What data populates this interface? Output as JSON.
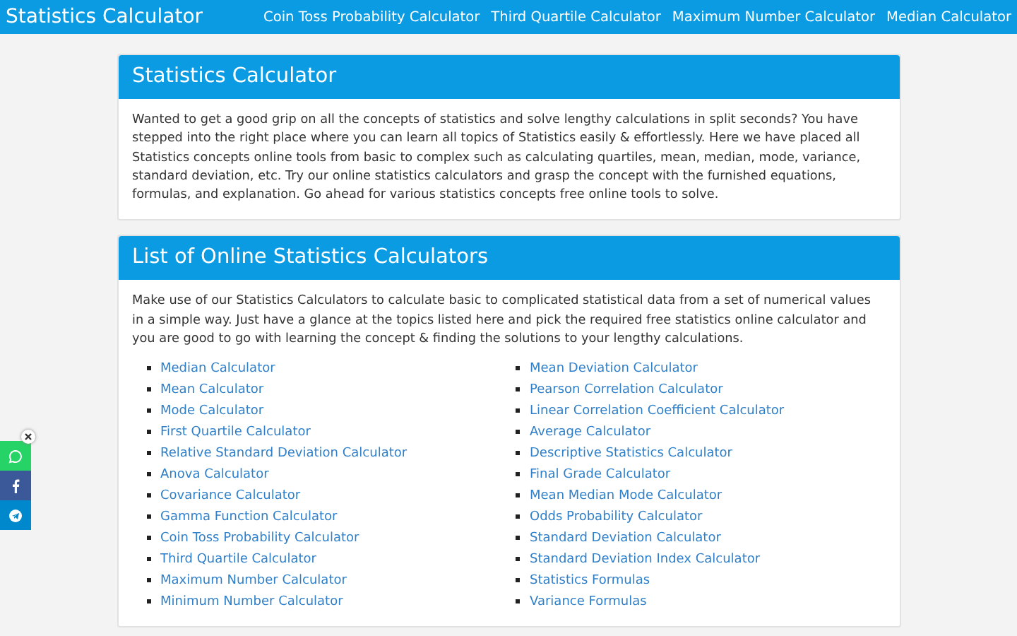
{
  "navbar": {
    "brand": "Statistics Calculator",
    "links": [
      "Coin Toss Probability Calculator",
      "Third Quartile Calculator",
      "Maximum Number Calculator",
      "Median Calculator"
    ]
  },
  "intro": {
    "title": "Statistics Calculator",
    "text": "Wanted to get a good grip on all the concepts of statistics and solve lengthy calculations in split seconds? You have stepped into the right place where you can learn all topics of Statistics easily & effortlessly. Here we have placed all Statistics concepts online tools from basic to complex such as calculating quartiles, mean, median, mode, variance, standard deviation, etc. Try our online statistics calculators and grasp the concept with the furnished equations, formulas, and explanation. Go ahead for various statistics concepts free online tools to solve."
  },
  "list_section": {
    "title": "List of Online Statistics Calculators",
    "text": "Make use of our Statistics Calculators to calculate basic to complicated statistical data from a set of numerical values in a simple way. Just have a glance at the topics listed here and pick the required free statistics online calculator and you are good to go with learning the concept & finding the solutions to your lengthy calculations.",
    "left_links": [
      "Median Calculator",
      "Mean Calculator",
      "Mode Calculator",
      "First Quartile Calculator",
      "Relative Standard Deviation Calculator",
      "Anova Calculator",
      "Covariance Calculator",
      "Gamma Function Calculator",
      "Coin Toss Probability Calculator",
      "Third Quartile Calculator",
      "Maximum Number Calculator",
      "Minimum Number Calculator"
    ],
    "right_links": [
      "Mean Deviation Calculator",
      "Pearson Correlation Calculator",
      "Linear Correlation Coefficient Calculator",
      "Average Calculator",
      "Descriptive Statistics Calculator",
      "Final Grade Calculator",
      "Mean Median Mode Calculator",
      "Odds Probability Calculator",
      "Standard Deviation Calculator",
      "Standard Deviation Index Calculator",
      "Statistics Formulas",
      "Variance Formulas"
    ]
  },
  "share_bar": {
    "buttons": [
      {
        "kind": "whatsapp",
        "color": "#25d366"
      },
      {
        "kind": "facebook",
        "color": "#3b5998"
      },
      {
        "kind": "telegram",
        "color": "#0088cc"
      }
    ]
  }
}
